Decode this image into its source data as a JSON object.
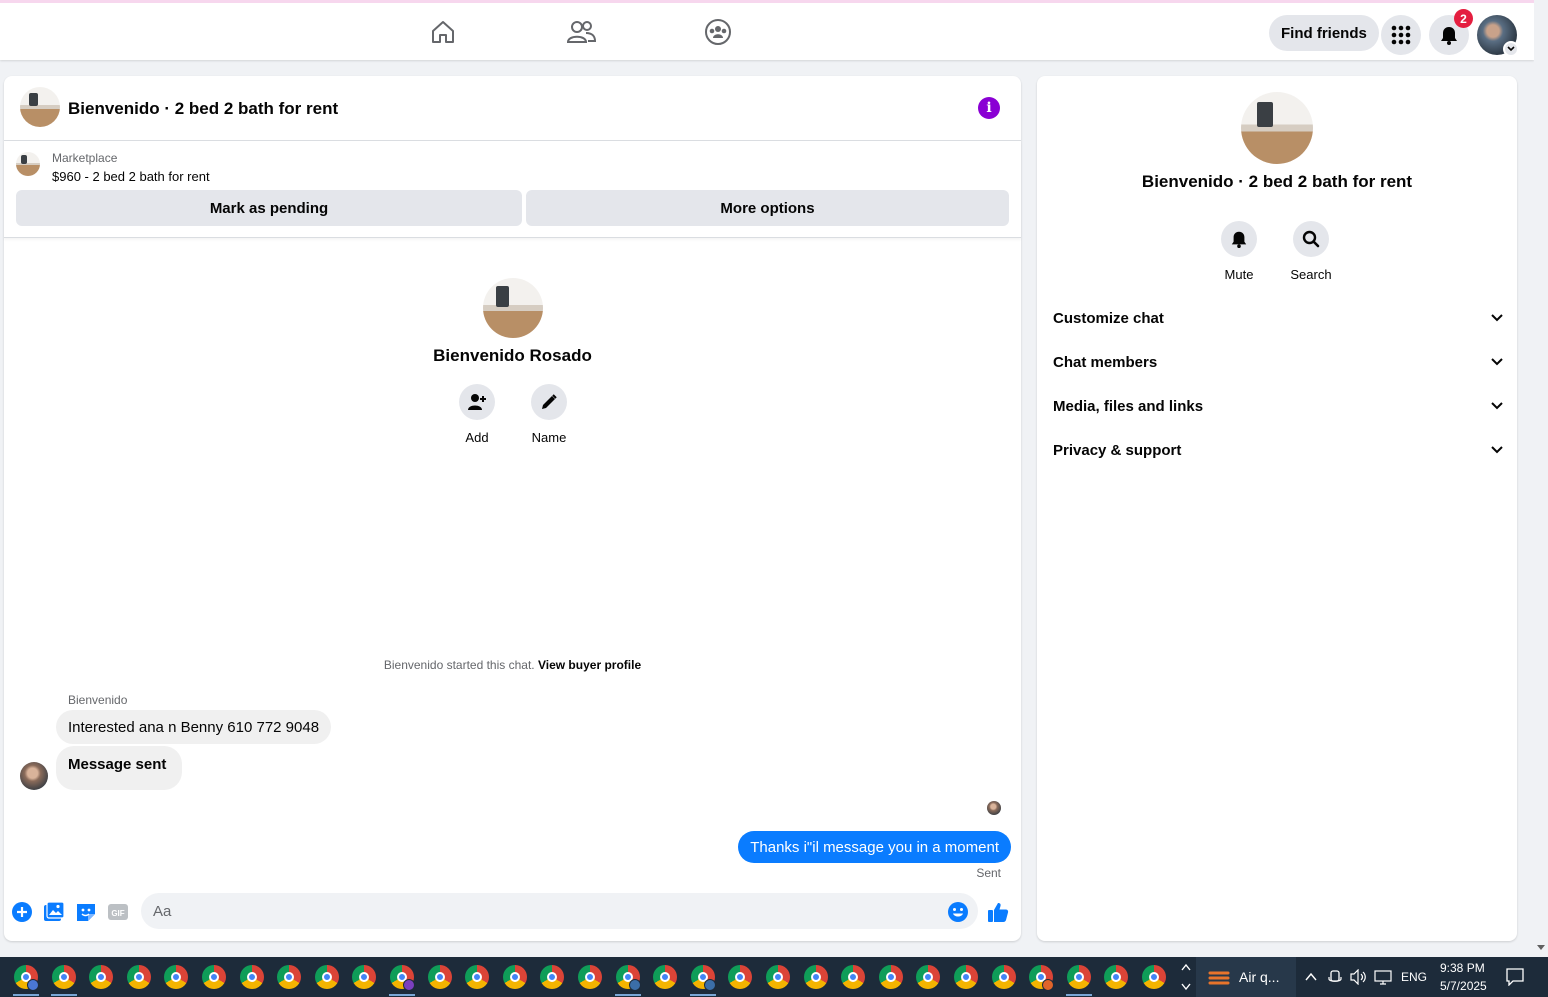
{
  "topbar": {
    "find_friends_label": "Find friends",
    "notification_count": "2"
  },
  "chat": {
    "header_title": "Bienvenido · 2 bed 2 bath for rent",
    "marketplace_label": "Marketplace",
    "listing_price_line": "$960 - 2 bed 2 bath for rent",
    "mark_pending_label": "Mark as pending",
    "more_options_label": "More options",
    "contact_name": "Bienvenido Rosado",
    "add_label": "Add",
    "name_label": "Name",
    "started_text": "Bienvenido started this chat.",
    "view_buyer_profile": "View buyer profile",
    "sender_name": "Bienvenido",
    "messages_in": [
      "Interested ana n Benny 610 772 9048",
      "Message sent"
    ],
    "message_out": "Thanks i\"il message you in a moment",
    "sent_status": "Sent",
    "composer_placeholder": "Aa"
  },
  "side": {
    "title": "Bienvenido · 2 bed 2 bath for rent",
    "mute_label": "Mute",
    "search_label": "Search",
    "sections": [
      "Customize chat",
      "Chat members",
      "Media, files and links",
      "Privacy & support"
    ]
  },
  "taskbar": {
    "weather_text": "Air q...",
    "language": "ENG",
    "time": "9:38 PM",
    "date": "5/7/2025"
  },
  "colors": {
    "accent_blue": "#0a7cff",
    "info_purple": "#8a00d4",
    "badge_red": "#e41e3f"
  }
}
